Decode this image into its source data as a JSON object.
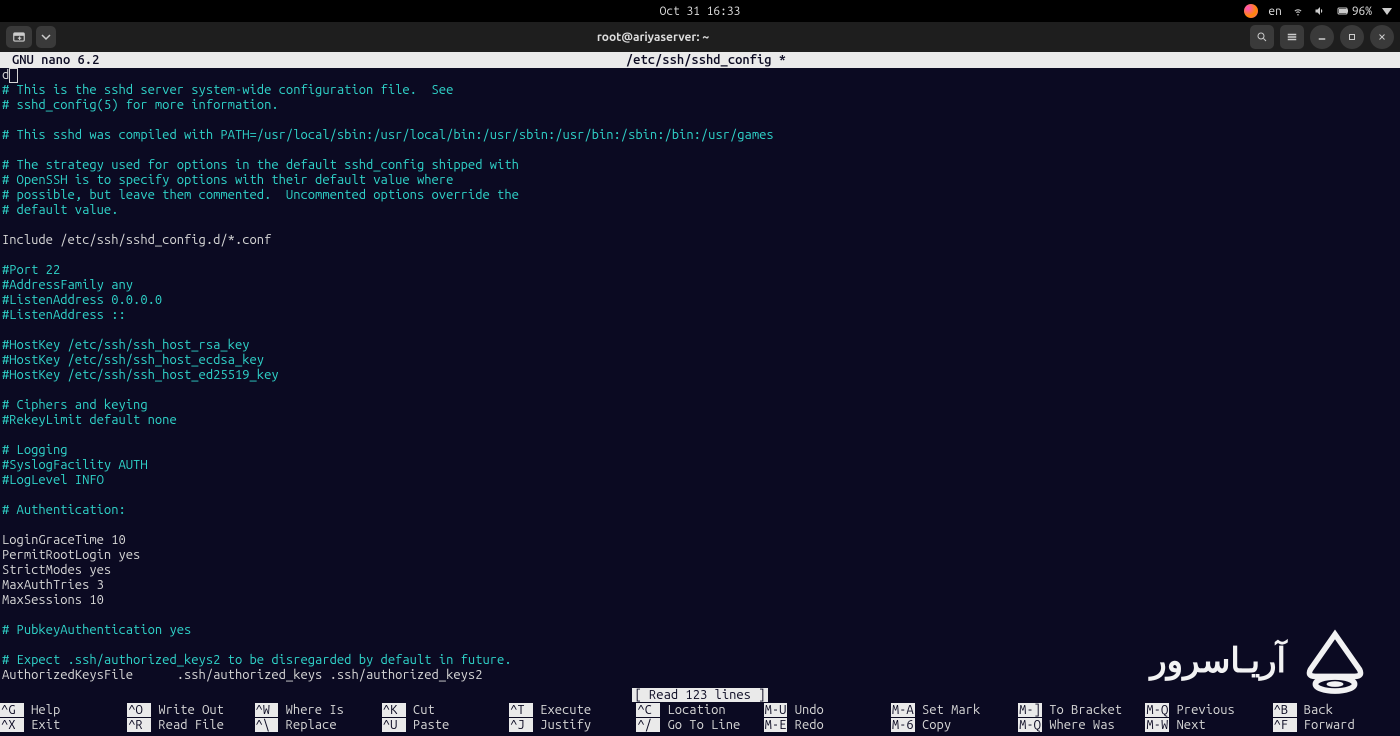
{
  "gnome": {
    "clock": "Oct 31  16:33",
    "lang": "en",
    "battery": "96%"
  },
  "window": {
    "title": "root@ariyaserver: ~"
  },
  "nano": {
    "app": "  GNU nano 6.2",
    "file": "/etc/ssh/sshd_config *",
    "status": "[ Read 123 lines ]"
  },
  "lines": [
    {
      "t": "cursor",
      "v": "d"
    },
    {
      "t": "comment",
      "v": "# This is the sshd server system-wide configuration file.  See"
    },
    {
      "t": "comment",
      "v": "# sshd_config(5) for more information."
    },
    {
      "t": "blank",
      "v": ""
    },
    {
      "t": "comment",
      "v": "# This sshd was compiled with PATH=/usr/local/sbin:/usr/local/bin:/usr/sbin:/usr/bin:/sbin:/bin:/usr/games"
    },
    {
      "t": "blank",
      "v": ""
    },
    {
      "t": "comment",
      "v": "# The strategy used for options in the default sshd_config shipped with"
    },
    {
      "t": "comment",
      "v": "# OpenSSH is to specify options with their default value where"
    },
    {
      "t": "comment",
      "v": "# possible, but leave them commented.  Uncommented options override the"
    },
    {
      "t": "comment",
      "v": "# default value."
    },
    {
      "t": "blank",
      "v": ""
    },
    {
      "t": "normal",
      "v": "Include /etc/ssh/sshd_config.d/*.conf"
    },
    {
      "t": "blank",
      "v": ""
    },
    {
      "t": "comment",
      "v": "#Port 22"
    },
    {
      "t": "comment",
      "v": "#AddressFamily any"
    },
    {
      "t": "comment",
      "v": "#ListenAddress 0.0.0.0"
    },
    {
      "t": "comment",
      "v": "#ListenAddress ::"
    },
    {
      "t": "blank",
      "v": ""
    },
    {
      "t": "comment",
      "v": "#HostKey /etc/ssh/ssh_host_rsa_key"
    },
    {
      "t": "comment",
      "v": "#HostKey /etc/ssh/ssh_host_ecdsa_key"
    },
    {
      "t": "comment",
      "v": "#HostKey /etc/ssh/ssh_host_ed25519_key"
    },
    {
      "t": "blank",
      "v": ""
    },
    {
      "t": "comment",
      "v": "# Ciphers and keying"
    },
    {
      "t": "comment",
      "v": "#RekeyLimit default none"
    },
    {
      "t": "blank",
      "v": ""
    },
    {
      "t": "comment",
      "v": "# Logging"
    },
    {
      "t": "comment",
      "v": "#SyslogFacility AUTH"
    },
    {
      "t": "comment",
      "v": "#LogLevel INFO"
    },
    {
      "t": "blank",
      "v": ""
    },
    {
      "t": "comment",
      "v": "# Authentication:"
    },
    {
      "t": "blank",
      "v": ""
    },
    {
      "t": "normal",
      "v": "LoginGraceTime 10"
    },
    {
      "t": "normal",
      "v": "PermitRootLogin yes"
    },
    {
      "t": "normal",
      "v": "StrictModes yes"
    },
    {
      "t": "normal",
      "v": "MaxAuthTries 3"
    },
    {
      "t": "normal",
      "v": "MaxSessions 10"
    },
    {
      "t": "blank",
      "v": ""
    },
    {
      "t": "comment",
      "v": "# PubkeyAuthentication yes"
    },
    {
      "t": "blank",
      "v": ""
    },
    {
      "t": "comment",
      "v": "# Expect .ssh/authorized_keys2 to be disregarded by default in future."
    },
    {
      "t": "normal",
      "v": "AuthorizedKeysFile      .ssh/authorized_keys .ssh/authorized_keys2"
    }
  ],
  "shortcuts": [
    [
      {
        "k": "^G",
        "l": "Help"
      },
      {
        "k": "^X",
        "l": "Exit"
      }
    ],
    [
      {
        "k": "^O",
        "l": "Write Out"
      },
      {
        "k": "^R",
        "l": "Read File"
      }
    ],
    [
      {
        "k": "^W",
        "l": "Where Is"
      },
      {
        "k": "^\\",
        "l": "Replace"
      }
    ],
    [
      {
        "k": "^K",
        "l": "Cut"
      },
      {
        "k": "^U",
        "l": "Paste"
      }
    ],
    [
      {
        "k": "^T",
        "l": "Execute"
      },
      {
        "k": "^J",
        "l": "Justify"
      }
    ],
    [
      {
        "k": "^C",
        "l": "Location"
      },
      {
        "k": "^/",
        "l": "Go To Line"
      }
    ],
    [
      {
        "k": "M-U",
        "l": "Undo"
      },
      {
        "k": "M-E",
        "l": "Redo"
      }
    ],
    [
      {
        "k": "M-A",
        "l": "Set Mark"
      },
      {
        "k": "M-6",
        "l": "Copy"
      }
    ],
    [
      {
        "k": "M-]",
        "l": "To Bracket"
      },
      {
        "k": "M-Q",
        "l": "Where Was"
      }
    ],
    [
      {
        "k": "M-Q",
        "l": "Previous"
      },
      {
        "k": "M-W",
        "l": "Next"
      }
    ],
    [
      {
        "k": "^B",
        "l": "Back"
      },
      {
        "k": "^F",
        "l": "Forward"
      }
    ]
  ],
  "watermark_text": "آریـاسرور"
}
